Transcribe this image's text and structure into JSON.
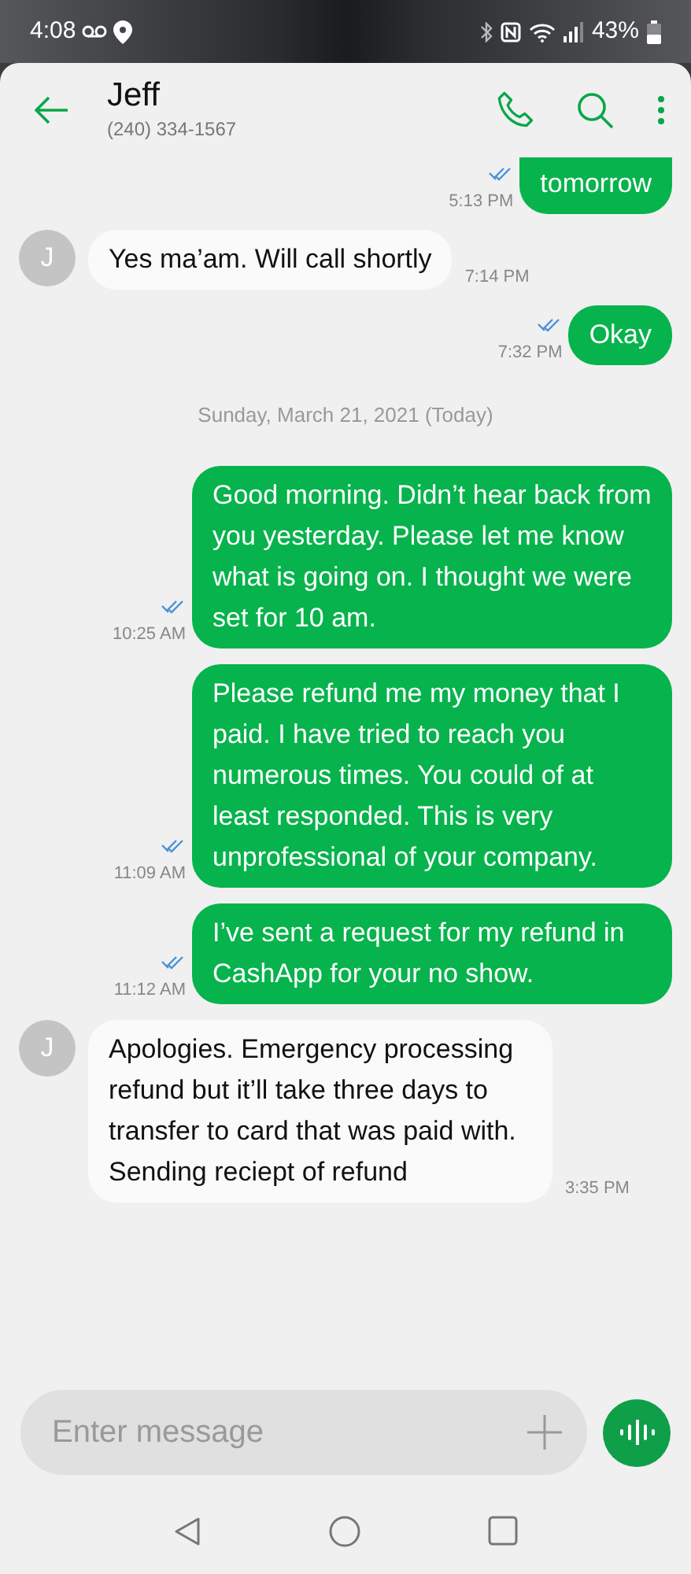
{
  "status_bar": {
    "time": "4:08",
    "battery": "43%"
  },
  "header": {
    "contact_name": "Jeff",
    "phone_number": "(240) 334-1567"
  },
  "messages": [
    {
      "kind": "sent",
      "text": "tomorrow",
      "time": "5:13 PM",
      "clipped": true
    },
    {
      "kind": "received",
      "avatar": "J",
      "text": "Yes ma’am. Will call shortly",
      "time": "7:14 PM"
    },
    {
      "kind": "sent",
      "text": "Okay",
      "time": "7:32 PM",
      "clipped": false
    },
    {
      "kind": "date",
      "text": "Sunday, March 21, 2021 (Today)"
    },
    {
      "kind": "sent",
      "text": "Good morning.  Didn’t hear back from you yesterday. Please let me know what is going on.  I thought we were set for 10 am.",
      "time": "10:25 AM",
      "clipped": false
    },
    {
      "kind": "sent",
      "text": "Please refund me my money that I paid.  I have tried to reach you numerous times. You could of at least responded.  This is very unprofessional of your company.",
      "time": "11:09 AM",
      "clipped": false
    },
    {
      "kind": "sent",
      "text": "I’ve sent a request for my refund in CashApp for your no show.",
      "time": "11:12 AM",
      "clipped": false
    },
    {
      "kind": "received",
      "avatar": "J",
      "text": "Apologies. Emergency processing refund but it’ll take three days to transfer to card that was paid with. Sending reciept of refund",
      "time": "3:35 PM"
    }
  ],
  "composer": {
    "placeholder": "Enter message"
  }
}
